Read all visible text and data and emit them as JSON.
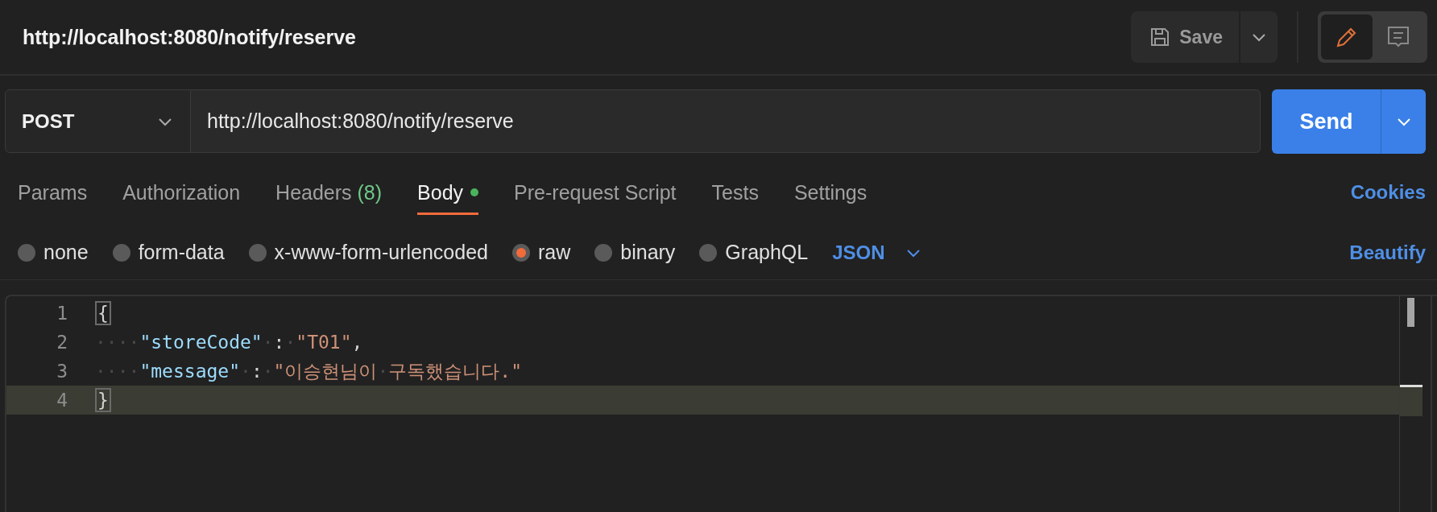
{
  "header": {
    "title": "http://localhost:8080/notify/reserve",
    "save_label": "Save",
    "modes": [
      {
        "kind": "edit",
        "selected": true
      },
      {
        "kind": "comments",
        "selected": false
      }
    ]
  },
  "request": {
    "method": "POST",
    "url": "http://localhost:8080/notify/reserve",
    "send_label": "Send"
  },
  "tabs": [
    {
      "label": "Params",
      "selected": false
    },
    {
      "label": "Authorization",
      "selected": false
    },
    {
      "label": "Headers",
      "count": "(8)",
      "selected": false
    },
    {
      "label": "Body",
      "dot": true,
      "selected": true
    },
    {
      "label": "Pre-request Script",
      "selected": false
    },
    {
      "label": "Tests",
      "selected": false
    },
    {
      "label": "Settings",
      "selected": false
    }
  ],
  "cookies_link": "Cookies",
  "body_types": [
    {
      "label": "none",
      "selected": false
    },
    {
      "label": "form-data",
      "selected": false
    },
    {
      "label": "x-www-form-urlencoded",
      "selected": false
    },
    {
      "label": "raw",
      "selected": true
    },
    {
      "label": "binary",
      "selected": false
    },
    {
      "label": "GraphQL",
      "selected": false
    }
  ],
  "format": "JSON",
  "beautify_link": "Beautify",
  "editor": {
    "lines": [
      {
        "number": "1",
        "current": false,
        "tokens": [
          {
            "kind": "brace-match",
            "text": "{"
          }
        ]
      },
      {
        "number": "2",
        "current": false,
        "tokens": [
          {
            "kind": "ws",
            "text": "····"
          },
          {
            "kind": "key",
            "text": "\"storeCode\""
          },
          {
            "kind": "ws",
            "text": "·"
          },
          {
            "kind": "punct",
            "text": ":"
          },
          {
            "kind": "ws",
            "text": "·"
          },
          {
            "kind": "string",
            "text": "\"T01\""
          },
          {
            "kind": "punct",
            "text": ","
          }
        ]
      },
      {
        "number": "3",
        "current": false,
        "tokens": [
          {
            "kind": "ws",
            "text": "····"
          },
          {
            "kind": "key",
            "text": "\"message\""
          },
          {
            "kind": "ws",
            "text": "·"
          },
          {
            "kind": "punct",
            "text": ":"
          },
          {
            "kind": "ws",
            "text": "·"
          },
          {
            "kind": "string",
            "text": "\"이승현님이"
          },
          {
            "kind": "ws",
            "text": "·"
          },
          {
            "kind": "string",
            "text": "구독했습니다.\""
          }
        ]
      },
      {
        "number": "4",
        "current": true,
        "tokens": [
          {
            "kind": "brace-match",
            "text": "}"
          }
        ]
      }
    ]
  }
}
